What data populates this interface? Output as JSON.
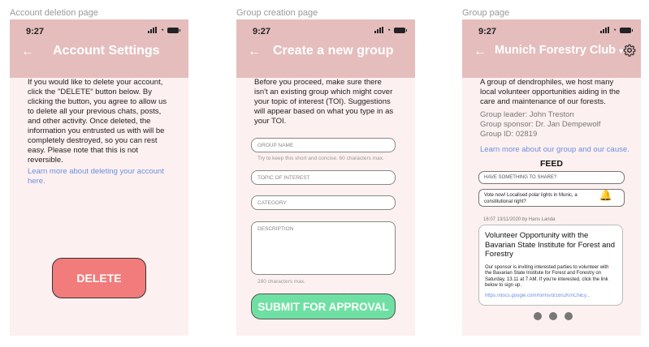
{
  "frames": [
    {
      "label": "Account deletion page"
    },
    {
      "label": "Group creation page"
    },
    {
      "label": "Group page"
    }
  ],
  "status": {
    "time": "9:27"
  },
  "icons": [
    "back-arrow-icon",
    "signal-icon",
    "wifi-icon",
    "battery-icon",
    "gear-icon",
    "bell-icon",
    "dropdown-caret-icon"
  ],
  "colors": {
    "header": "#e5bdbd",
    "background": "#fdf0f0",
    "delete": "#f27b7b",
    "submit": "#6fe0a3",
    "link": "#6c8fe0"
  },
  "account": {
    "title": "Account Settings",
    "paragraph": "If you would like to delete your account, click the \"DELETE\" button below. By clicking the button, you agree to allow us to delete all your previous chats, posts, and other activity. Once deleted, the information you entrusted us with will be completely destroyed, so you can rest easy. Please note that this is not reversible.",
    "link": "Learn more about deleting your account here.",
    "delete_label": "DELETE"
  },
  "create": {
    "title": "Create a new group",
    "paragraph": "Before you proceed, make sure there isn't an existing group which might cover your topic of interest (TOI). Suggestions will appear based on what you type in as your TOI.",
    "group_name_placeholder": "GROUP NAME",
    "group_name_hint": "Try to keep this short and concise. 60 characters max.",
    "topic_placeholder": "TOPIC OF INTEREST",
    "category_placeholder": "CATEGORY",
    "description_placeholder": "DESCRIPTION",
    "description_hint": "280 characters max.",
    "submit_label": "SUBMIT FOR APPROVAL"
  },
  "group": {
    "title": "Munich Forestry Club",
    "caret": "▾",
    "description": "A group of dendrophiles, we host many local volunteer opportunities aiding in the care and maintenance of our forests.",
    "leader": "Group leader: John Treston",
    "sponsor": "Group sponsor: Dr. Jan Dempewolf",
    "group_id": "Group ID: 02819",
    "learn_more": "Learn more about our group and our cause.",
    "feed_title": "FEED",
    "share_placeholder": "HAVE SOMETHING TO SHARE?",
    "vote_text": "Vote now! Localised polar lights in Munic, a constitutional right?",
    "post_meta": "16:07 13/11/2020 by Hans Landa",
    "post_title": "Volunteer Opportunity with the Bavarian State Institute for Forest and Forestry",
    "post_body": "Our sponsor is inviting interested parties to volunteer with the Bavarian State Institute for Forest and Forestry on Saturday, 13.11 at 7 AM. If you're interested, click the link below to sign up.",
    "post_link": "https://docs.google.com/forms/d/16n2KmChiEy..."
  }
}
